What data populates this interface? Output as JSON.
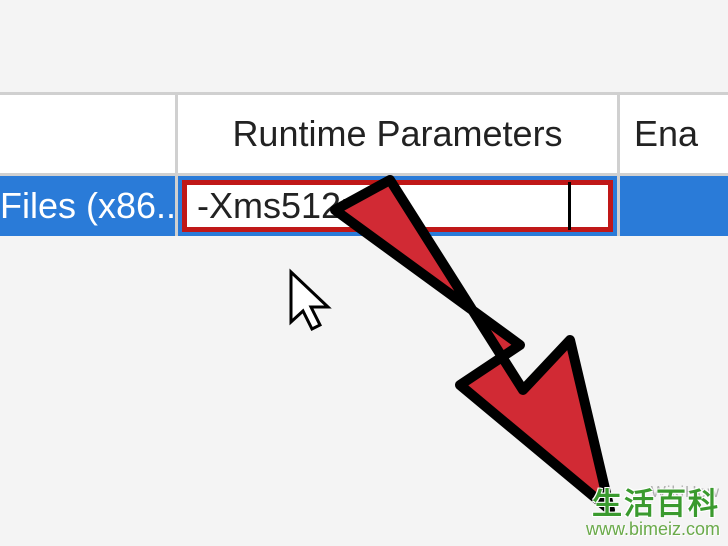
{
  "table": {
    "headers": {
      "files": "",
      "runtime": "Runtime Parameters",
      "enabled": "Ena"
    },
    "row": {
      "files": "Files (x86...",
      "runtime_value": "-Xms512m",
      "enabled": ""
    }
  },
  "watermark": {
    "title": "生活百科",
    "url": "www.bimeiz.com",
    "faint": "WikiHow"
  },
  "colors": {
    "highlight_row": "#2a7bd8",
    "input_border": "#c01818",
    "arrow_fill": "#d12a34",
    "arrow_stroke": "#000000"
  }
}
